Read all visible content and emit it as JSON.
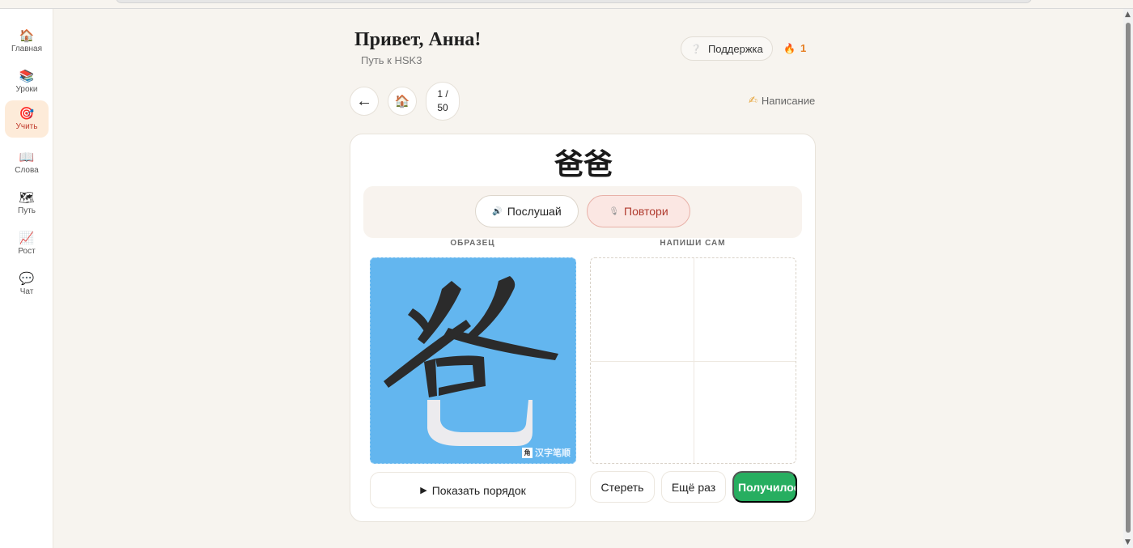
{
  "sidebar": {
    "items": [
      {
        "label": "Главная",
        "icon": "🏠",
        "icon_name": "home-icon",
        "active": false
      },
      {
        "label": "Уроки",
        "icon": "📚",
        "icon_name": "books-icon",
        "active": false
      },
      {
        "label": "Учить",
        "icon": "🎯",
        "icon_name": "target-icon",
        "active": true
      },
      {
        "label": "Слова",
        "icon": "📖",
        "icon_name": "open-book-icon",
        "active": false
      },
      {
        "label": "Путь",
        "icon": "🗺",
        "icon_name": "map-icon",
        "active": false
      },
      {
        "label": "Рост",
        "icon": "📈",
        "icon_name": "chart-up-icon",
        "active": false
      },
      {
        "label": "Чат",
        "icon": "💬",
        "icon_name": "chat-bubble-icon",
        "active": false
      }
    ]
  },
  "header": {
    "greeting": "Привет, Анна!",
    "subtitle": "Путь к HSK3",
    "support_label": "Поддержка",
    "support_icon": "❔",
    "streak_icon": "🔥",
    "streak_count": "1"
  },
  "nav": {
    "back_icon": "←",
    "home_icon": "🏠",
    "counter_top": "1 /",
    "counter_bottom": "50",
    "mode_icon": "✍",
    "mode_label": "Написание"
  },
  "card": {
    "word": "爸爸",
    "listen_icon": "🔊",
    "listen_label": "Послушай",
    "repeat_icon": "🎙",
    "repeat_label": "Повтори",
    "sample_label": "ОБРАЗЕЦ",
    "write_label": "НАПИШИ САМ",
    "watermark_box": "角",
    "watermark_text": "汉字笔顺",
    "show_order_icon": "▶",
    "show_order_label": "Показать порядок",
    "erase_label": "Стереть",
    "again_label": "Ещё раз",
    "success_label": "Получилось"
  },
  "colors": {
    "accent_green": "#27ae60",
    "sample_bg": "#63b6ef",
    "active_nav_bg": "#fdebd9",
    "repeat_bg": "#fbe7e3"
  }
}
